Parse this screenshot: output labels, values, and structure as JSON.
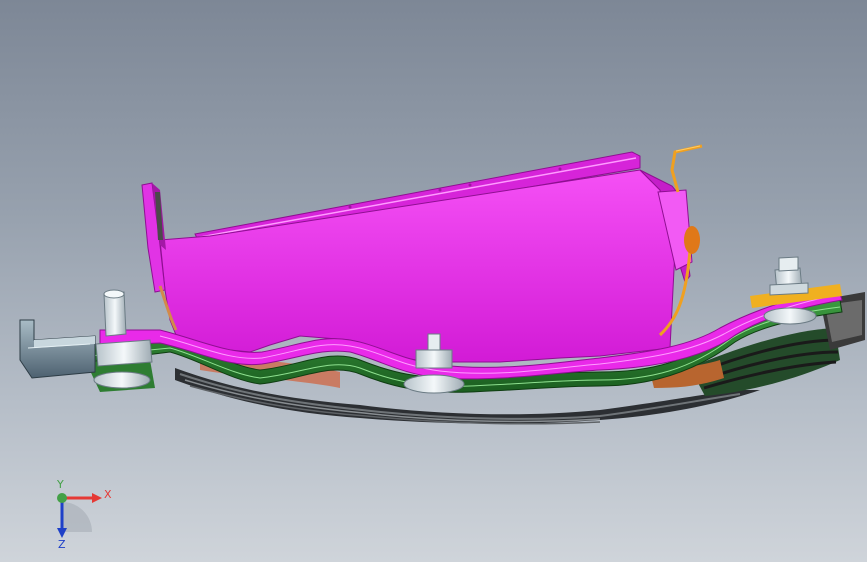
{
  "viewport": {
    "background_top": "#7d8796",
    "background_bottom": "#cfd4da"
  },
  "model": {
    "parts": [
      {
        "name": "housing",
        "color": "#ee22ee"
      },
      {
        "name": "spring-plates",
        "color": "#2e7d32"
      },
      {
        "name": "copper-plates",
        "color": "#c97b63"
      },
      {
        "name": "wire",
        "color": "#f0a020"
      },
      {
        "name": "bolts",
        "color": "#dfe6ea"
      },
      {
        "name": "bracket",
        "color": "#6f8a9a"
      }
    ]
  },
  "triad": {
    "x_label": "X",
    "y_label": "Y",
    "z_label": "Z",
    "x_color": "#e53935",
    "y_color": "#43a047",
    "z_color": "#1e40c8"
  }
}
